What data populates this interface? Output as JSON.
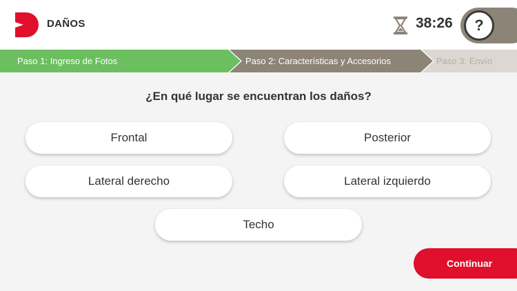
{
  "header": {
    "title": "DAÑOS",
    "timer": "38:26",
    "help_label": "?",
    "logo_icon": "brand-logo-icon",
    "timer_icon": "hourglass-icon"
  },
  "steps": [
    {
      "label": "Paso 1: Ingreso de Fotos",
      "state": "completed"
    },
    {
      "label": "Paso 2: Características y Accesorios",
      "state": "current"
    },
    {
      "label": "Paso 3: Envío",
      "state": "pending"
    }
  ],
  "question": "¿En qué lugar se encuentran los daños?",
  "options": [
    {
      "label": "Frontal"
    },
    {
      "label": "Posterior"
    },
    {
      "label": "Lateral derecho"
    },
    {
      "label": "Lateral izquierdo"
    },
    {
      "label": "Techo"
    }
  ],
  "continue_label": "Continuar",
  "colors": {
    "brand_red": "#e00f2b",
    "step_completed": "#6cbf5f",
    "step_current": "#8d8478",
    "step_pending": "#dcd7d1",
    "background": "#f4f4f4"
  }
}
